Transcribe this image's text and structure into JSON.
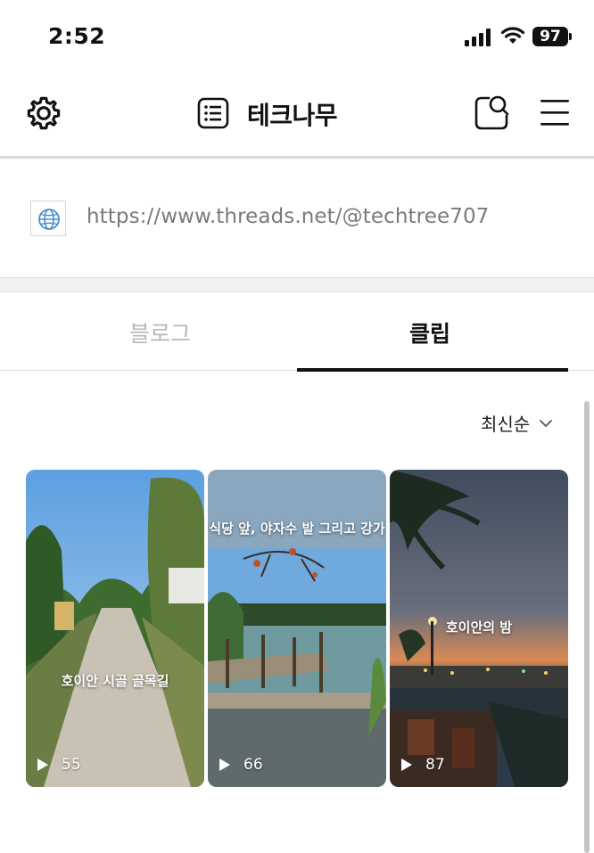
{
  "status_bar": {
    "time": "2:52",
    "battery": "97"
  },
  "header": {
    "title": "테크나무"
  },
  "url_row": {
    "url": "https://www.threads.net/@techtree707"
  },
  "tabs": [
    {
      "label": "블로그",
      "active": false
    },
    {
      "label": "클립",
      "active": true
    }
  ],
  "sort": {
    "label": "최신순"
  },
  "clips": [
    {
      "caption": "호이안 시골 골목길",
      "views": "55"
    },
    {
      "caption": "식당 앞, 야자수 밭 그리고 강가",
      "views": "66"
    },
    {
      "caption": "호이안의 밤",
      "views": "87"
    }
  ],
  "colors": {
    "active_tab": "#111111",
    "inactive_tab": "#b8b8b8",
    "url_text": "#7a7a7a",
    "globe": "#4a90c8"
  }
}
